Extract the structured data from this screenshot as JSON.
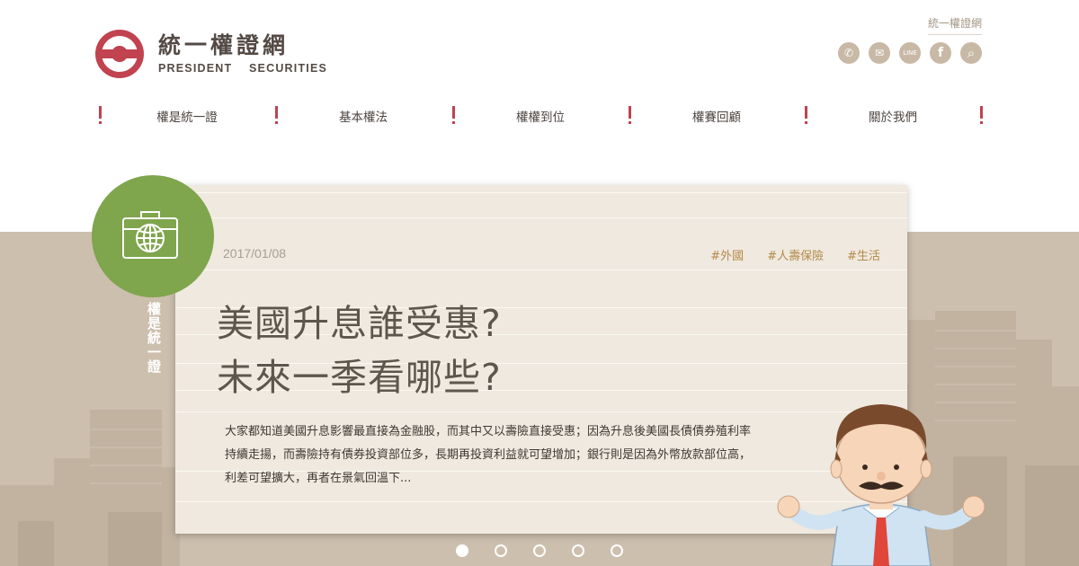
{
  "header": {
    "logo_cn": "統一權證網",
    "logo_en": "PRESIDENT  SECURITIES",
    "top_link": "統一權證網",
    "social": [
      {
        "icon": "phone-icon",
        "glyph": "✆"
      },
      {
        "icon": "mail-icon",
        "glyph": "✉"
      },
      {
        "icon": "line-icon",
        "glyph": "LINE"
      },
      {
        "icon": "facebook-icon",
        "glyph": "f"
      },
      {
        "icon": "search-icon",
        "glyph": "⌕"
      }
    ]
  },
  "nav": {
    "items": [
      "權是統一證",
      "基本權法",
      "權權到位",
      "權賽回顧",
      "關於我們"
    ]
  },
  "slide": {
    "side_label": "權是統一證",
    "date": "2017/01/08",
    "tags": [
      "#外國",
      "#人壽保險",
      "#生活"
    ],
    "title_line1": "美國升息誰受惠?",
    "title_line2": "未來一季看哪些?",
    "body_line1": "大家都知道美國升息影響最直接為金融股，而其中又以壽險直接受惠；因為升息後美國長債債券殖利率",
    "body_line2": "持續走揚，而壽險持有債券投資部位多，長期再投資利益就可望增加；銀行則是因為外幣放款部位高，",
    "body_line3": "利差可望擴大，再者在景氣回溫下..."
  },
  "carousel": {
    "total": 5,
    "active": 1
  },
  "colors": {
    "brand_red": "#c0434f",
    "badge_green": "#7fa54d",
    "band_beige": "#cdbfae",
    "tag_gold": "#b48a4a"
  }
}
